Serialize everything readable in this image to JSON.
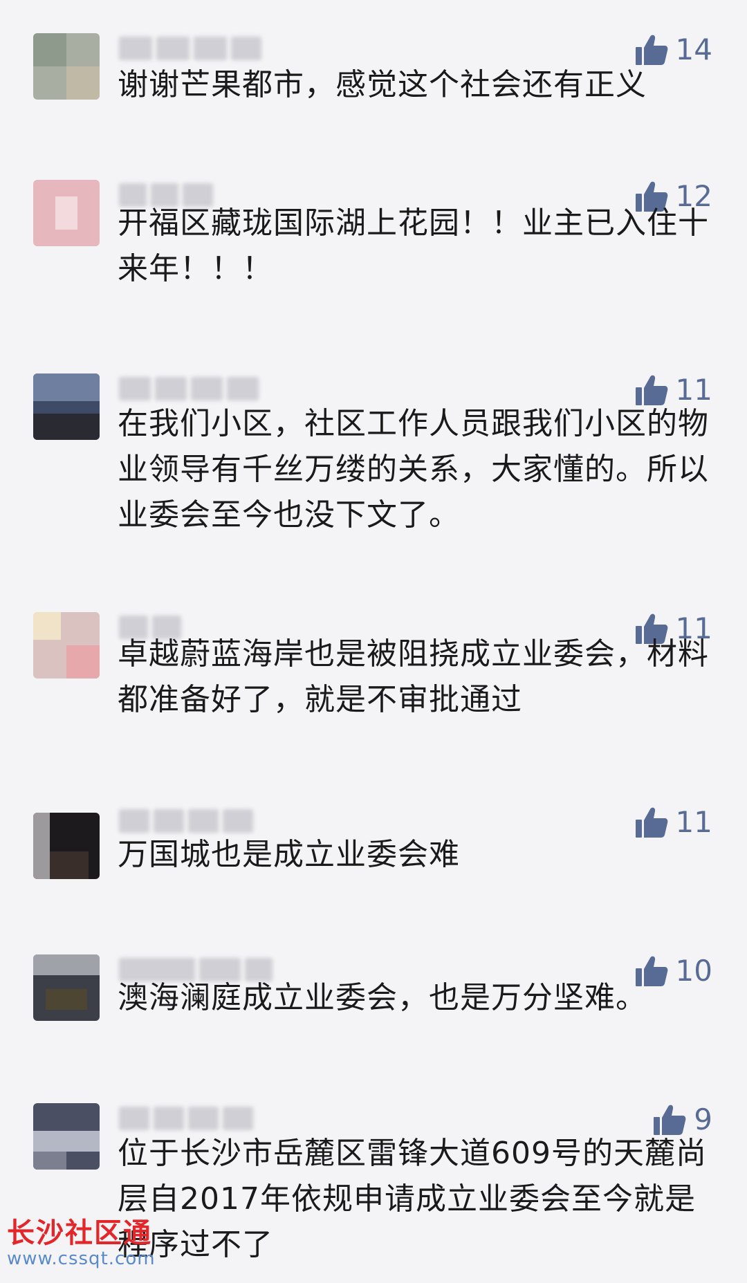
{
  "comments": [
    {
      "likes": "14",
      "text": "谢谢芒果都市，感觉这个社会还有正义"
    },
    {
      "likes": "12",
      "text": "开福区藏珑国际湖上花园！！业主已入住十来年！！！"
    },
    {
      "likes": "11",
      "text": "在我们小区，社区工作人员跟我们小区的物业领导有千丝万缕的关系，大家懂的。所以业委会至今也没下文了。"
    },
    {
      "likes": "11",
      "text": "卓越蔚蓝海岸也是被阻挠成立业委会，材料都准备好了，就是不审批通过"
    },
    {
      "likes": "11",
      "text": "万国城也是成立业委会难"
    },
    {
      "likes": "10",
      "text": "澳海澜庭成立业委会，也是万分坚难。"
    },
    {
      "likes": "9",
      "text": "位于长沙市岳麓区雷锋大道609号的天麓尚层自2017年依规申请成立业委会至今就是程序过不了"
    }
  ],
  "icons": {
    "like": "thumbs-up-icon",
    "avatar": "blurred-avatar"
  },
  "colors": {
    "like": "#576b95",
    "text": "#1a1a1a",
    "background": "#f4f4f6",
    "watermark": "#e3262a"
  },
  "watermark": {
    "title": "长沙社区通",
    "url": "www.cssqt.com"
  }
}
